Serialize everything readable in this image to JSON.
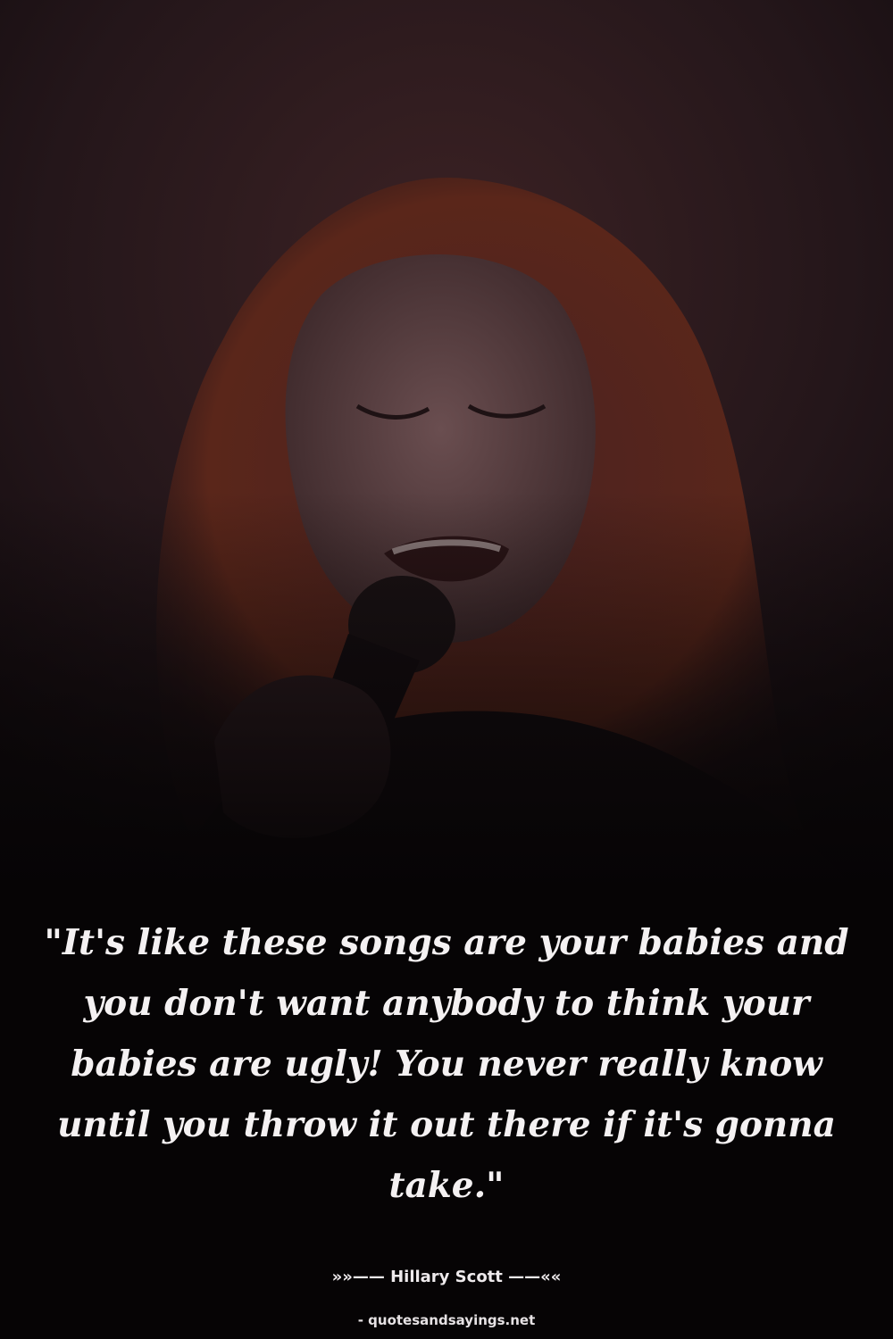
{
  "colors": {
    "background": "#060405",
    "quote_text": "#f4f1f2",
    "photo_tone": "#3a1f22",
    "hair_tone": "#5a2418"
  },
  "photo": {
    "description_icon": "singer-photo"
  },
  "quote": {
    "text": "\"It's like these songs are your babies and you don't want anybody to think your babies are ugly! You never really know until you throw it out there if it's gonna take.\""
  },
  "attribution": {
    "author_line": "»»—— Hillary Scott ——««"
  },
  "footer": {
    "source": "- quotesandsayings.net"
  }
}
